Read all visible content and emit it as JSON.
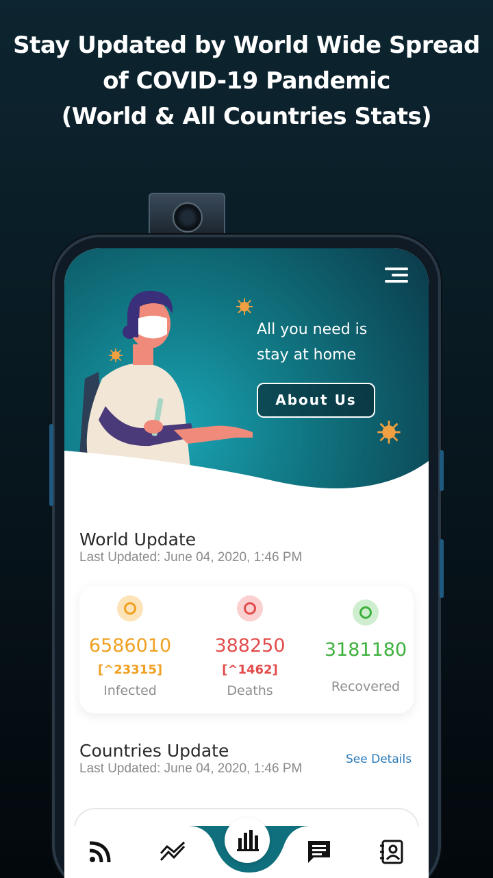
{
  "promo": {
    "headline_line1": "Stay Updated by World Wide Spread",
    "headline_line2": "of COVID-19 Pandemic",
    "headline_line3": "(World & All Countries Stats)"
  },
  "hero": {
    "tagline_line1": "All you need is",
    "tagline_line2": "stay at home",
    "about_button": "About Us"
  },
  "world": {
    "title": "World Update",
    "last_updated": "Last Updated: June 04, 2020, 1:46 PM",
    "stats": [
      {
        "value": "6586010",
        "delta": "[^23315]",
        "label": "Infected",
        "color": "#f0a020",
        "bg": "#fde3b8"
      },
      {
        "value": "388250",
        "delta": "[^1462]",
        "label": "Deaths",
        "color": "#e24b4b",
        "bg": "#fad0d0"
      },
      {
        "value": "3181180",
        "delta": "",
        "label": "Recovered",
        "color": "#3cb03c",
        "bg": "#cfeecf"
      }
    ]
  },
  "countries": {
    "title": "Countries Update",
    "last_updated": "Last Updated: June 04, 2020, 1:46 PM",
    "see_details": "See Details"
  },
  "nav": {
    "items": [
      "rss-icon",
      "trend-icon",
      "bar-chart-icon",
      "chat-icon",
      "contact-book-icon"
    ],
    "active": "bar-chart-icon",
    "accent": "#0f6f7c"
  }
}
